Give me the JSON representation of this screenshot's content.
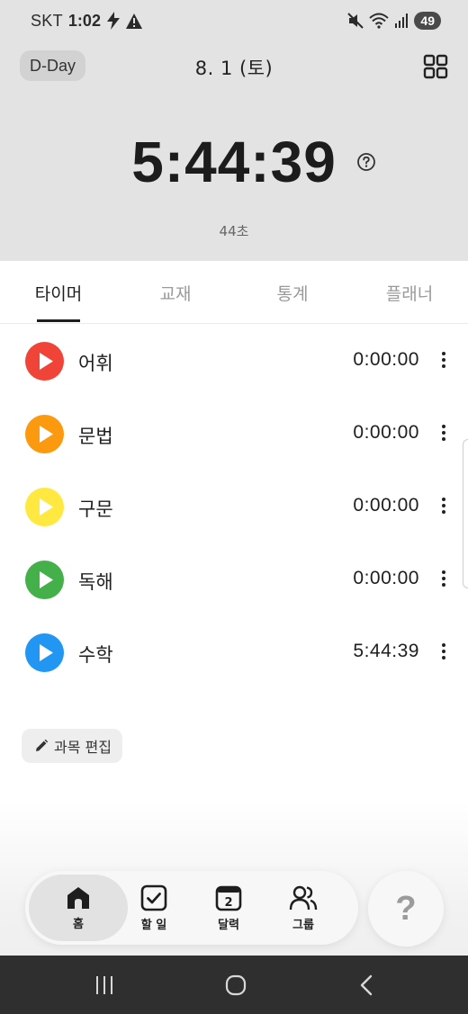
{
  "status_bar": {
    "carrier": "SKT",
    "time": "1:02",
    "battery": "49"
  },
  "header": {
    "dday_label": "D-Day",
    "date": "8. 1 (토)",
    "timer": "5:44:39",
    "seconds_label": "44초"
  },
  "tabs": [
    {
      "label": "타이머",
      "active": true
    },
    {
      "label": "교재",
      "active": false
    },
    {
      "label": "통계",
      "active": false
    },
    {
      "label": "플래너",
      "active": false
    }
  ],
  "subjects": [
    {
      "name": "어휘",
      "time": "0:00:00",
      "color": "#f04438"
    },
    {
      "name": "문법",
      "time": "0:00:00",
      "color": "#fb9a0e"
    },
    {
      "name": "구문",
      "time": "0:00:00",
      "color": "#ffe941"
    },
    {
      "name": "독해",
      "time": "0:00:00",
      "color": "#43b04a"
    },
    {
      "name": "수학",
      "time": "5:44:39",
      "color": "#2196f3"
    }
  ],
  "edit_button": {
    "label": "과목 편집"
  },
  "bottom_nav": [
    {
      "label": "홈",
      "icon": "home-icon",
      "active": true
    },
    {
      "label": "할 일",
      "icon": "checkbox-icon",
      "active": false
    },
    {
      "label": "달력",
      "icon": "calendar-icon",
      "active": false,
      "badge": "2"
    },
    {
      "label": "그룹",
      "icon": "group-icon",
      "active": false
    }
  ],
  "help_fab": {
    "label": "?"
  }
}
